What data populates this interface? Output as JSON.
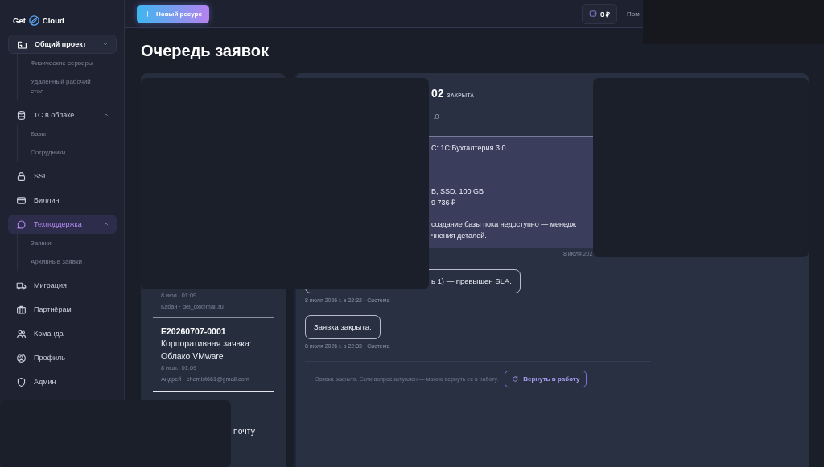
{
  "sidebar": {
    "logo_left": "Get",
    "logo_right": "Cloud",
    "items": [
      {
        "label": "Общий проект",
        "kind": "project",
        "selected": false,
        "children": [
          {
            "label": "Физические серверы",
            "selected": false
          },
          {
            "label": "Удалённый рабочий стол",
            "selected": false
          }
        ]
      },
      {
        "label": "1С в облаке",
        "kind": "group",
        "selected": false,
        "expanded": true,
        "children": [
          {
            "label": "Базы",
            "selected": false
          },
          {
            "label": "Сотрудники",
            "selected": false
          }
        ]
      },
      {
        "label": "SSL",
        "kind": "link",
        "selected": false
      },
      {
        "label": "Биллинг",
        "kind": "link",
        "selected": false
      },
      {
        "label": "Техподдержка",
        "kind": "group",
        "selected": true,
        "expanded": true,
        "children": [
          {
            "label": "Заявки",
            "selected": false
          },
          {
            "label": "Архивные заявки",
            "selected": false
          }
        ]
      },
      {
        "label": "Миграция",
        "kind": "link",
        "selected": false
      },
      {
        "label": "Партнёрам",
        "kind": "link",
        "selected": false
      },
      {
        "label": "Команда",
        "kind": "link",
        "selected": false
      },
      {
        "label": "Профиль",
        "kind": "link",
        "selected": false
      },
      {
        "label": "Админ",
        "kind": "link",
        "selected": false
      }
    ]
  },
  "topbar": {
    "new_button": "Новый ресурс",
    "balance": "0 ₽",
    "help_link": "Пом"
  },
  "page_title": "Очередь заявок",
  "ticket_list": {
    "items": [
      {
        "date": "8 июл., 01:09",
        "author": "Кабан · dei_dx@mail.ru"
      },
      {
        "id": "E20260707-0001",
        "title": "Корпоративная заявка: Облако VMware",
        "date": "8 июл., 01:09",
        "author": "Андрей · chemist661@gmail.com"
      },
      {
        "title": "почту"
      }
    ]
  },
  "detail": {
    "id": "02",
    "status": "ЗАКРЫТА",
    "subtitle": ".0",
    "request_lines": [
      "С: 1С:Бухгалтерия 3.0",
      "B, SSD: 100 GB",
      "9 736 ₽",
      "создание базы пока недоступно — менедж",
      "чнения деталей."
    ],
    "request_meta": "8 июля 202",
    "messages": [
      {
        "text": "ь 1) — превышен SLA.",
        "meta": "8 июля 2026 г. в 22:32 · Система"
      },
      {
        "text": "Заявка закрыта.",
        "meta": "8 июля 2026 г. в 22:33 · Система"
      }
    ],
    "closed_note": "Заявка закрыта. Если вопрос актуален — можно вернуть ее в работу.",
    "reopen_button": "Вернуть в работу"
  }
}
